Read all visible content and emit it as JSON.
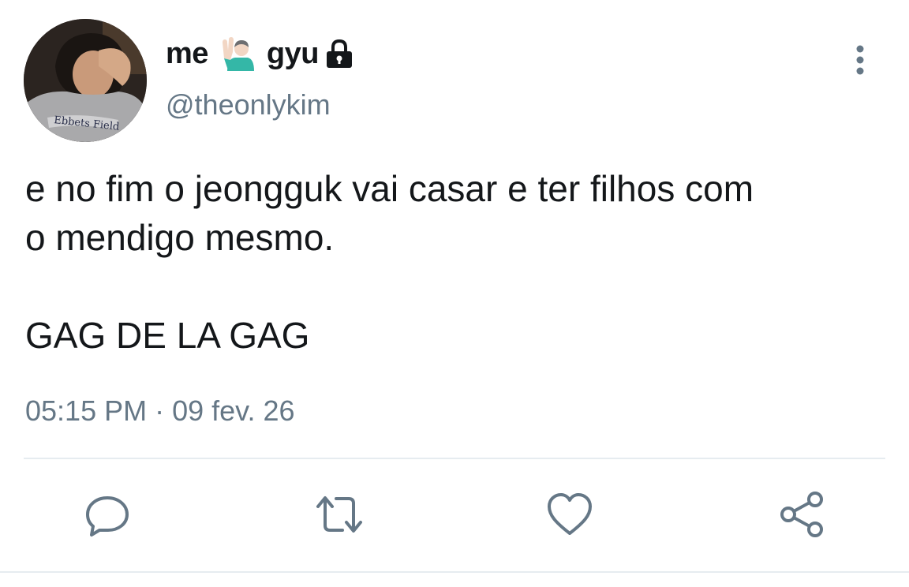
{
  "user": {
    "name_part1": "me",
    "name_emoji": "person-raising-hand-emoji",
    "name_part2": "gyu",
    "lock_icon": "lock-icon",
    "handle": "@theonlykim"
  },
  "tweet": {
    "line1": "e no fim o jeongguk vai casar e ter filhos com",
    "line2": "o mendigo mesmo.",
    "line3": "GAG DE LA GAG"
  },
  "meta": {
    "time": "05:15 PM",
    "separator": "·",
    "date": "09 fev. 26"
  },
  "actions": [
    {
      "icon": "reply-icon"
    },
    {
      "icon": "retweet-icon"
    },
    {
      "icon": "like-icon"
    },
    {
      "icon": "share-icon"
    }
  ],
  "colors": {
    "text": "#14171a",
    "secondary": "#657786",
    "divider": "#e6ecf0"
  }
}
